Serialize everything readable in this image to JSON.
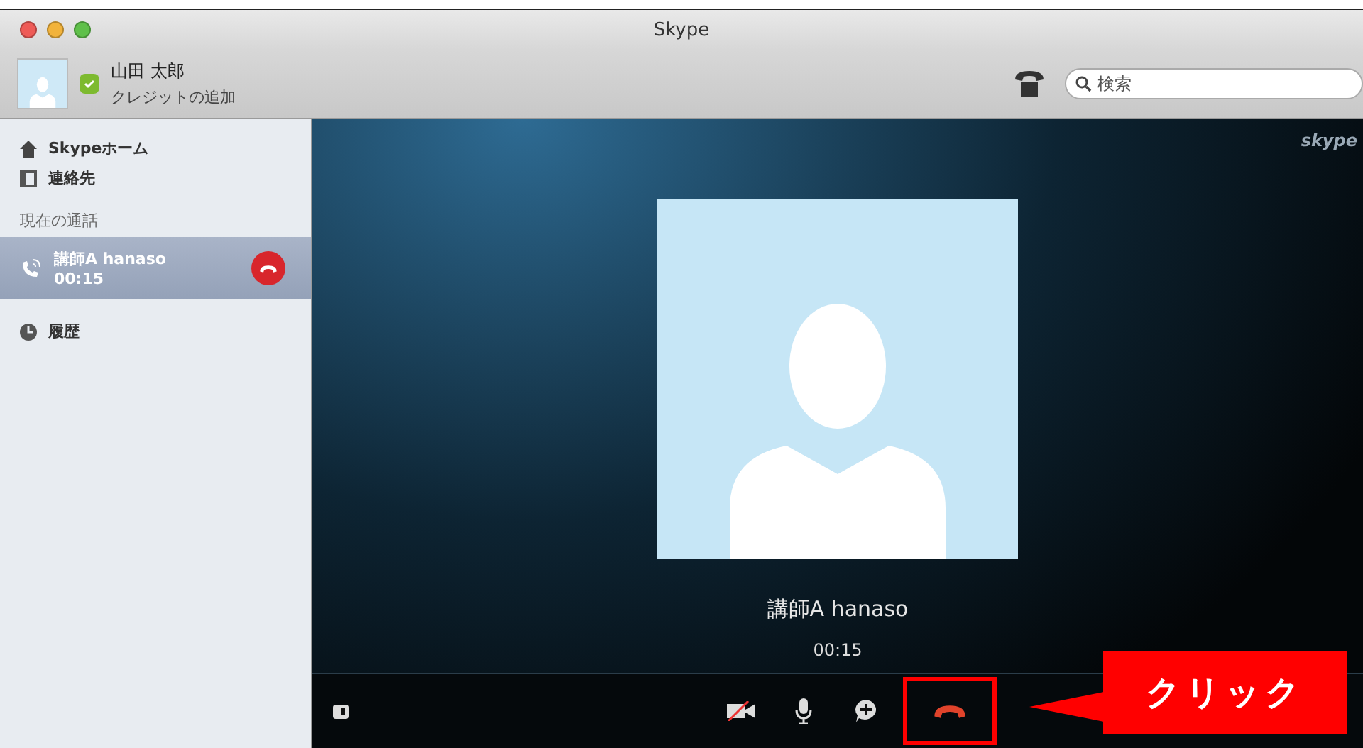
{
  "window": {
    "title": "Skype"
  },
  "profile": {
    "name": "山田 太郎",
    "credit_link": "クレジットの追加"
  },
  "search": {
    "placeholder": "検索"
  },
  "sidebar": {
    "items": [
      {
        "kind": "home",
        "label": "Skypeホーム",
        "selected": false
      },
      {
        "kind": "contacts",
        "label": "連絡先",
        "selected": false
      },
      {
        "kind": "header",
        "label": "現在の通話"
      },
      {
        "kind": "call",
        "label": "講師A hanaso",
        "time": "00:15",
        "selected": true
      },
      {
        "kind": "history",
        "label": "履歴",
        "selected": false
      }
    ]
  },
  "call": {
    "logo": "skype",
    "name": "講師A hanaso",
    "time": "00:15"
  },
  "controls": [
    {
      "kind": "video"
    },
    {
      "kind": "mic"
    },
    {
      "kind": "add"
    },
    {
      "kind": "hangup",
      "highlighted": true
    }
  ],
  "callout": {
    "text": "クリック"
  }
}
